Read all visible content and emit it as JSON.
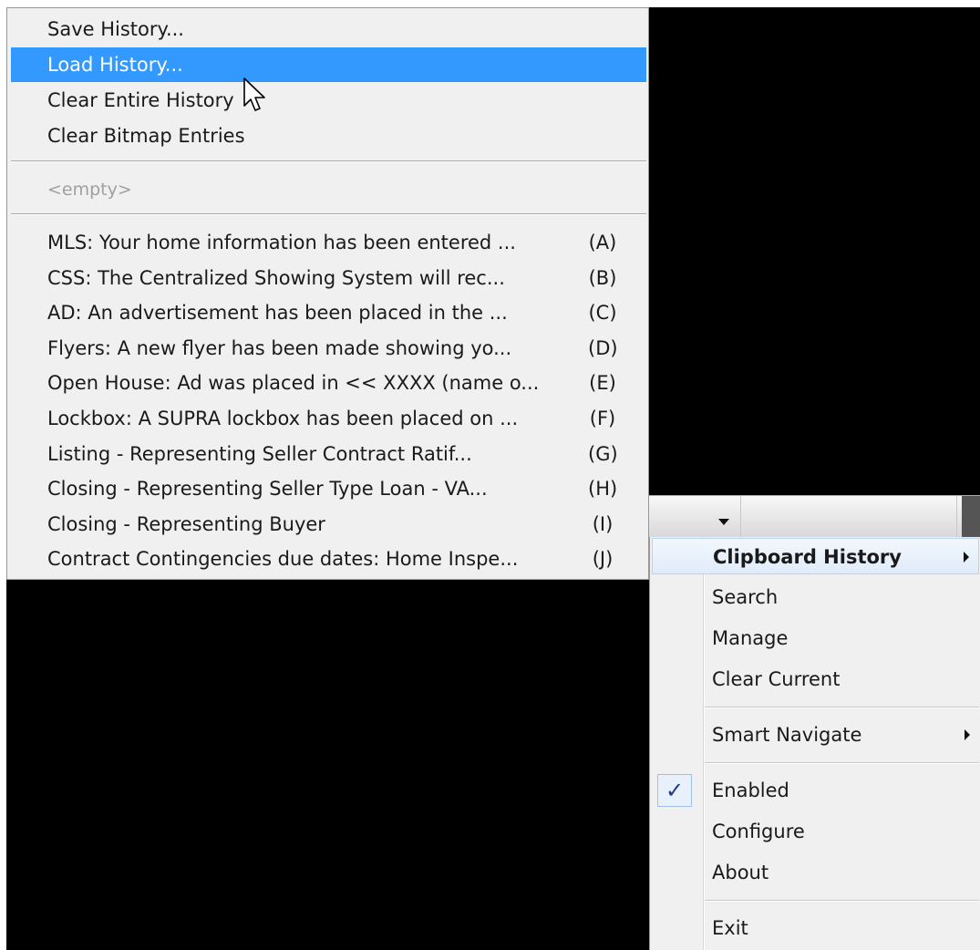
{
  "history_menu": {
    "actions": [
      {
        "label": "Save History..."
      },
      {
        "label": "Load History..."
      },
      {
        "label": "Clear Entire History"
      },
      {
        "label": "Clear Bitmap Entries"
      }
    ],
    "empty_label": "<empty>",
    "entries": [
      {
        "label": "MLS:  Your home information has been entered ...",
        "key": "(A)"
      },
      {
        "label": "CSS:  The Centralized Showing System will rec...",
        "key": "(B)"
      },
      {
        "label": "AD:  An advertisement has been placed in the ...",
        "key": "(C)"
      },
      {
        "label": "Flyers:  A new flyer has been made showing yo...",
        "key": "(D)"
      },
      {
        "label": "Open House:  Ad was placed in << XXXX (name o...",
        "key": "(E)"
      },
      {
        "label": "Lockbox:  A SUPRA lockbox has been placed on ...",
        "key": "(F)"
      },
      {
        "label": "Listing - Representing Seller  Contract Ratif...",
        "key": "(G)"
      },
      {
        "label": "Closing - Representing Seller  Type Loan - VA...",
        "key": "(H)"
      },
      {
        "label": "Closing - Representing Buyer",
        "key": "(I)"
      },
      {
        "label": "Contract Contingencies due dates:  Home Inspe...",
        "key": "(J)"
      }
    ]
  },
  "tray_menu": {
    "clipboard_history": "Clipboard History",
    "search": "Search",
    "manage": "Manage",
    "clear_current": "Clear Current",
    "smart_navigate": "Smart Navigate",
    "enabled": "Enabled",
    "configure": "Configure",
    "about": "About",
    "exit": "Exit",
    "check_glyph": "✓"
  },
  "icons": {
    "cursor": "arrow-cursor-icon",
    "submenu": "submenu-arrow-icon",
    "dropdown": "chevron-down-icon"
  },
  "colors": {
    "highlight": "#3399ff",
    "menu_bg": "#f0f0f0",
    "desktop": "#000000"
  }
}
